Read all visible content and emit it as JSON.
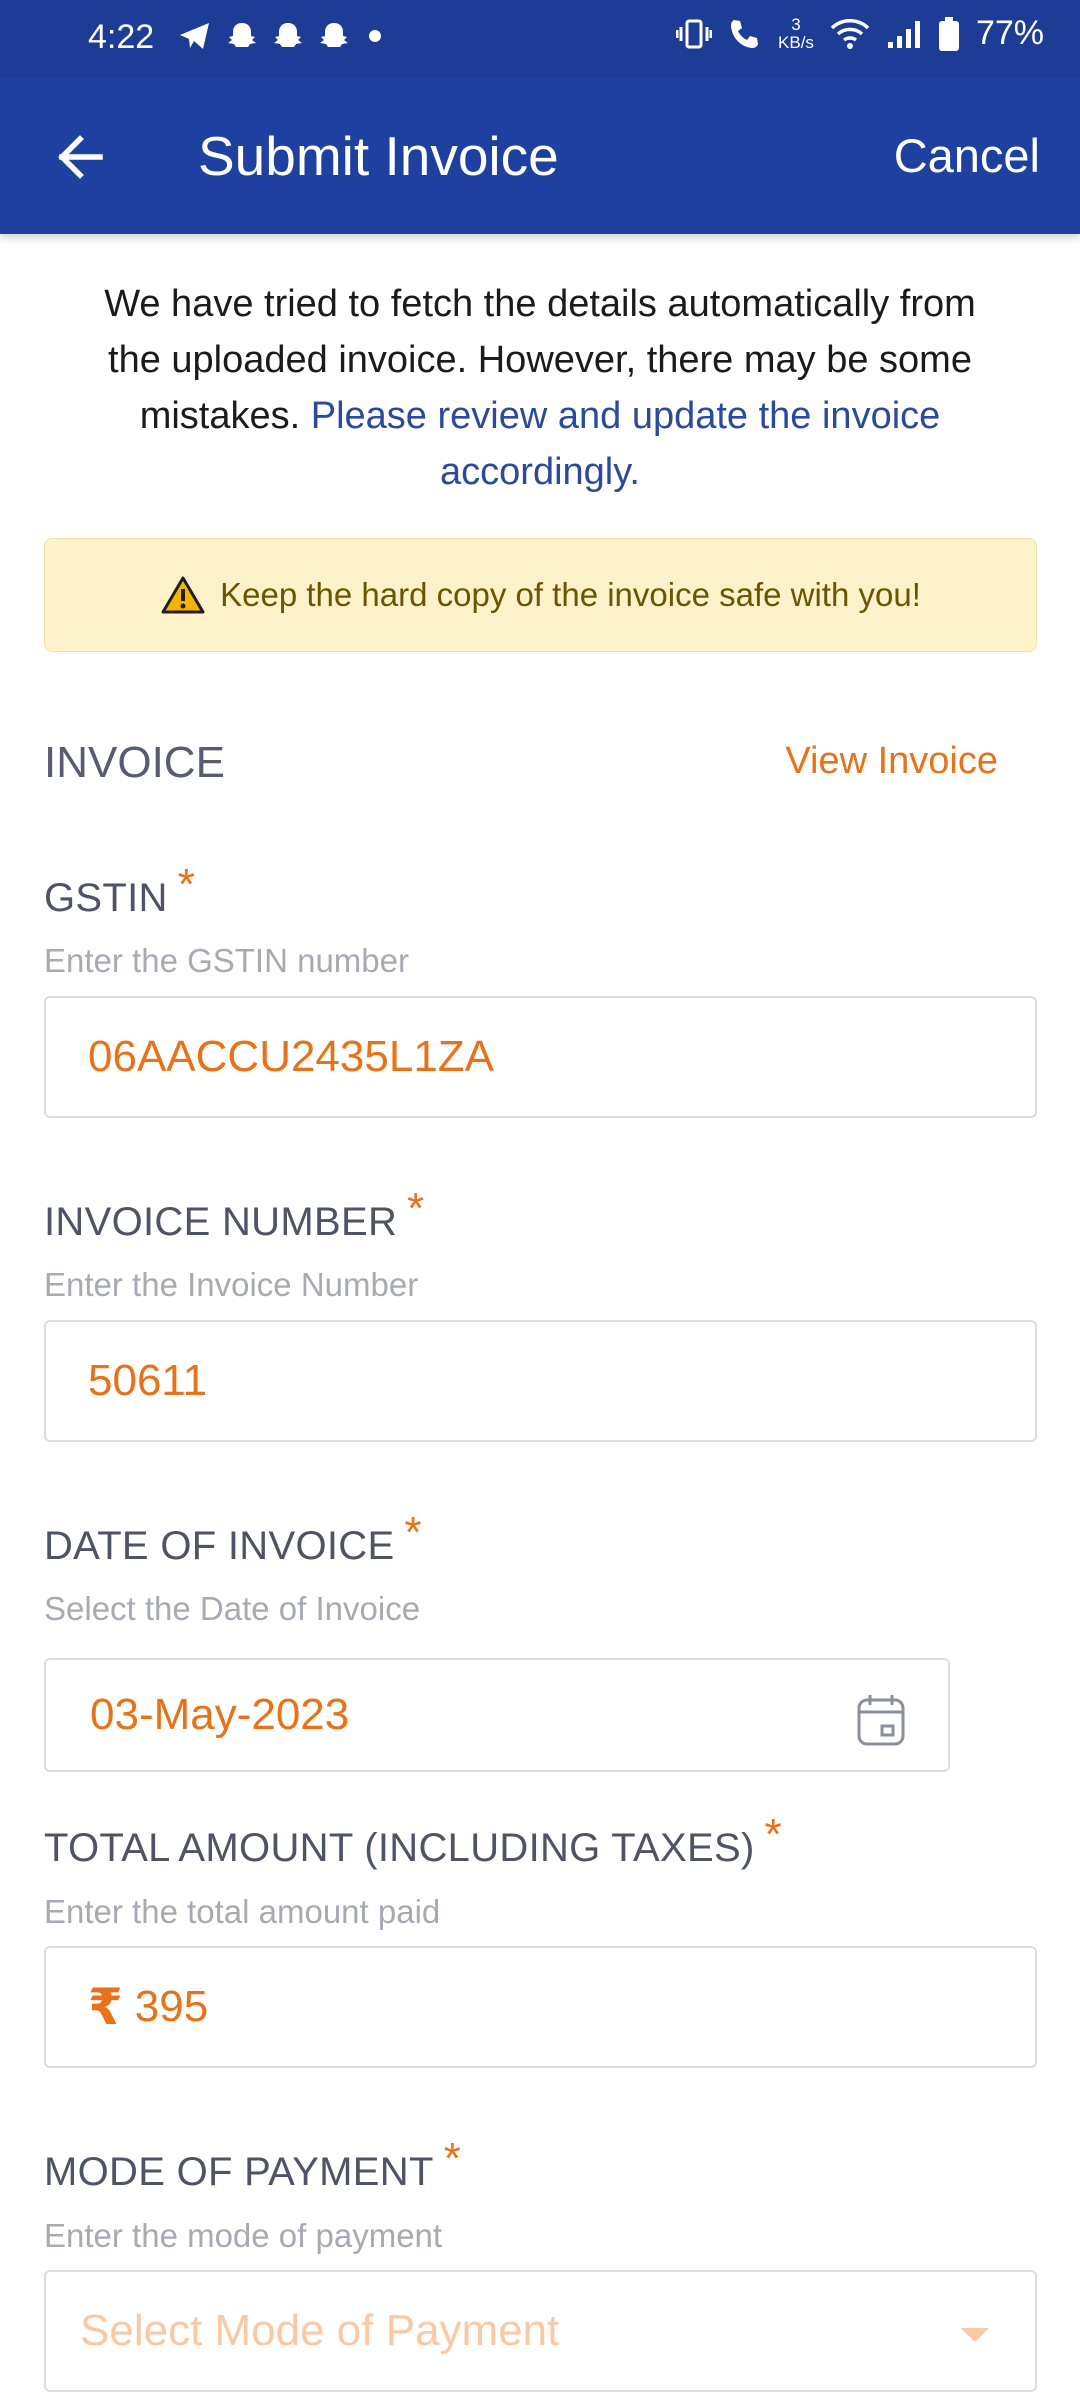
{
  "status_bar": {
    "time": "4:22",
    "network_speed_value": "3",
    "network_speed_unit": "KB/s",
    "battery": "77%",
    "icons": [
      "telegram-icon",
      "snapchat-icon",
      "snapchat-icon",
      "snapchat-icon",
      "dot-icon",
      "vibrate-icon",
      "wifi-call-icon",
      "wifi-icon",
      "signal-icon",
      "battery-icon"
    ]
  },
  "app_bar": {
    "title": "Submit Invoice",
    "cancel_label": "Cancel",
    "back_icon": "arrow-left-icon"
  },
  "intro": {
    "text_plain": "We have tried to fetch the details automatically from the uploaded invoice. However, there may be some mistakes.",
    "text_highlight": "Please review and update the invoice accordingly."
  },
  "warning": {
    "icon": "warning-triangle-icon",
    "text": "Keep the hard copy of the invoice safe with you!"
  },
  "section": {
    "title": "INVOICE",
    "view_link": "View Invoice"
  },
  "fields": {
    "gstin": {
      "label": "GSTIN",
      "required": "*",
      "help": "Enter the GSTIN number",
      "value": "06AACCU2435L1ZA"
    },
    "invoice_number": {
      "label": "INVOICE NUMBER",
      "required": "*",
      "help": "Enter the Invoice Number",
      "value": "50611"
    },
    "date": {
      "label": "DATE OF INVOICE",
      "required": "*",
      "help": "Select the Date of Invoice",
      "value": "03-May-2023",
      "icon": "calendar-icon"
    },
    "total_amount": {
      "label": "TOTAL AMOUNT (INCLUDING TAXES)",
      "required": "*",
      "help": "Enter the total amount paid",
      "currency_symbol": "₹",
      "value": "395"
    },
    "payment_mode": {
      "label": "MODE OF PAYMENT",
      "required": "*",
      "help": "Enter the mode of payment",
      "placeholder": "Select Mode of Payment"
    }
  },
  "colors": {
    "status_bar": "#1d3c95",
    "app_bar": "#1e40a0",
    "accent": "#e8721a",
    "link_blue": "#2b4a9c",
    "warning_bg": "#fdf2c9"
  }
}
